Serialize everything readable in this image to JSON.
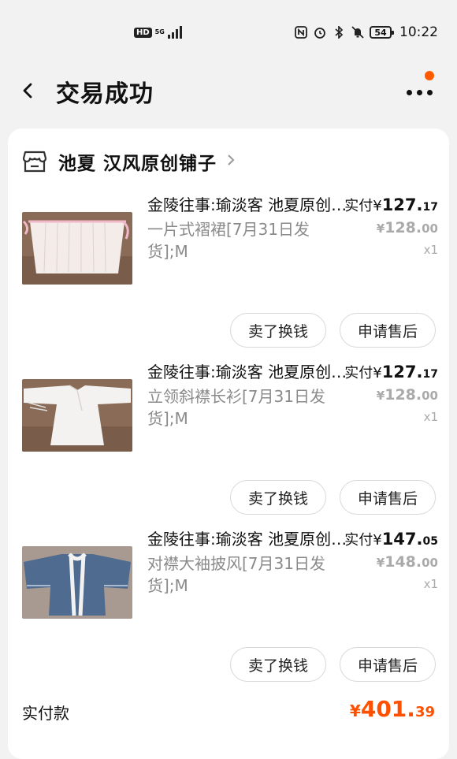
{
  "status_bar": {
    "hd": "HD",
    "network": "5G",
    "battery": "54",
    "time": "10:22"
  },
  "header": {
    "title": "交易成功"
  },
  "shop": {
    "name": "池夏 汉风原创铺子"
  },
  "items": [
    {
      "title": "金陵往事:瑜淡客 池夏原创复原...",
      "sku": "一片式褶裙[7月31日发货];M",
      "paid_label": "实付",
      "paid_currency": "¥",
      "paid_int": "127.",
      "paid_dec": "17",
      "orig_currency": "¥",
      "orig_int": "128.",
      "orig_dec": "00",
      "qty": "x1",
      "btn_sell": "卖了换钱",
      "btn_after": "申请售后"
    },
    {
      "title": "金陵往事:瑜淡客 池夏原创复原...",
      "sku": "立领斜襟长衫[7月31日发货];M",
      "paid_label": "实付",
      "paid_currency": "¥",
      "paid_int": "127.",
      "paid_dec": "17",
      "orig_currency": "¥",
      "orig_int": "128.",
      "orig_dec": "00",
      "qty": "x1",
      "btn_sell": "卖了换钱",
      "btn_after": "申请售后"
    },
    {
      "title": "金陵往事:瑜淡客 池夏原创复原...",
      "sku": "对襟大袖披风[7月31日发货];M",
      "paid_label": "实付",
      "paid_currency": "¥",
      "paid_int": "147.",
      "paid_dec": "05",
      "orig_currency": "¥",
      "orig_int": "148.",
      "orig_dec": "00",
      "qty": "x1",
      "btn_sell": "卖了换钱",
      "btn_after": "申请售后"
    }
  ],
  "total": {
    "label": "实付款",
    "currency": "¥",
    "int": "401.",
    "dec": "39"
  },
  "colors": {
    "accent": "#ff5000",
    "notify_dot": "#ff5a00"
  }
}
